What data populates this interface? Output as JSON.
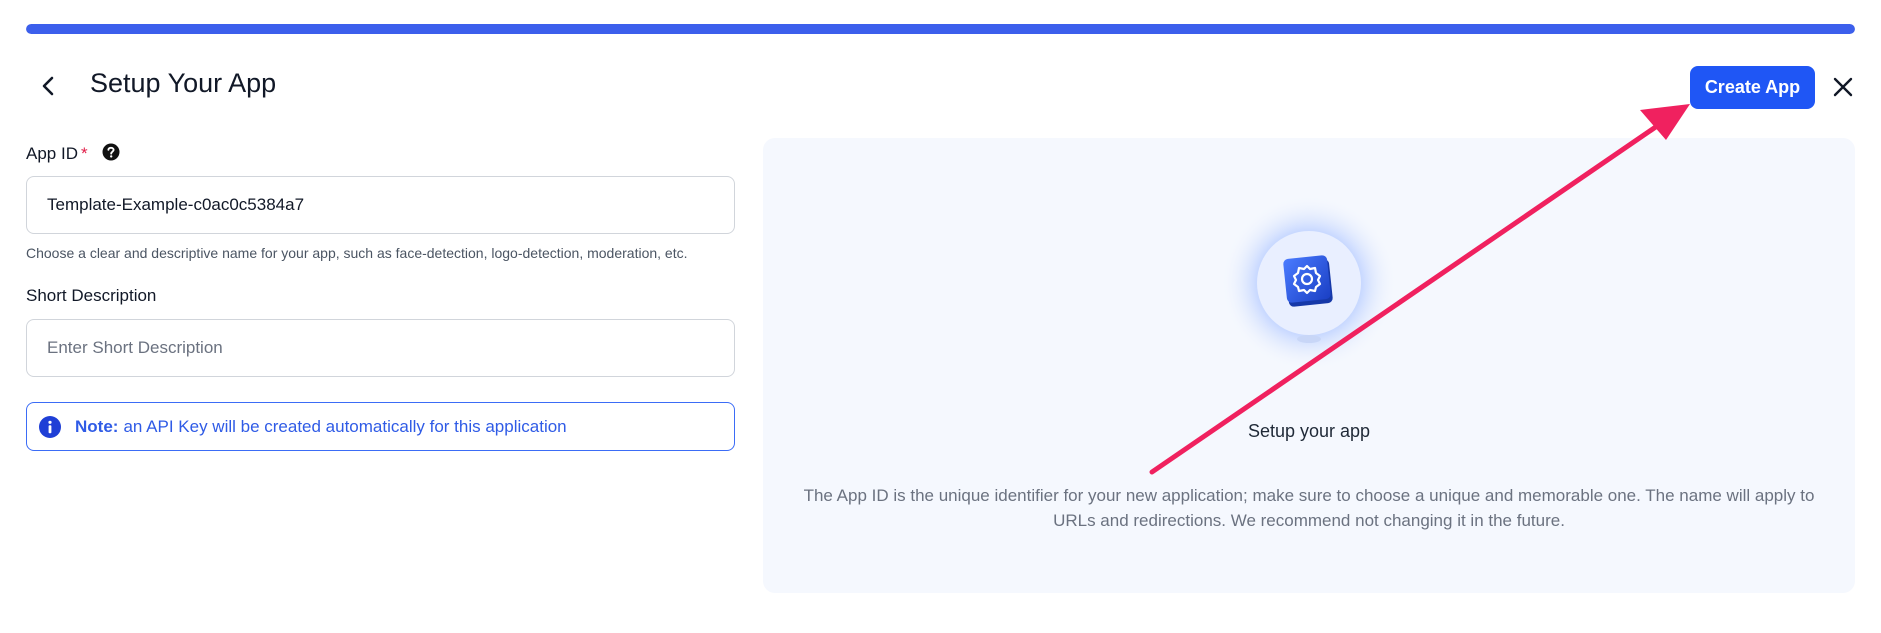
{
  "header": {
    "title": "Setup Your App",
    "create_label": "Create App",
    "progress_percent": 100
  },
  "form": {
    "app_id": {
      "label": "App ID",
      "required_mark": "*",
      "value": "Template-Example-c0ac0c5384a7",
      "hint": "Choose a clear and descriptive name for your app, such as face-detection, logo-detection, moderation, etc."
    },
    "short_description": {
      "label": "Short Description",
      "placeholder": "Enter Short Description",
      "value": ""
    },
    "note": {
      "strong": "Note:",
      "text": "an API Key will be created automatically for this application"
    }
  },
  "panel": {
    "title": "Setup your app",
    "description": "The App ID is the unique identifier for your new application; make sure to choose a unique and memorable one. The name will apply to URLs and redirections. We recommend not changing it in the future."
  },
  "icons": {
    "back": "chevron-left-icon",
    "close": "close-icon",
    "help": "question-circle-icon",
    "info": "info-circle-icon",
    "illustration": "app-gear-icon"
  },
  "colors": {
    "accent": "#1f56f5",
    "progress": "#3c5fec",
    "note": "#2f5be6",
    "panel_bg": "#f5f8fe",
    "annotation_arrow": "#f0215f"
  }
}
